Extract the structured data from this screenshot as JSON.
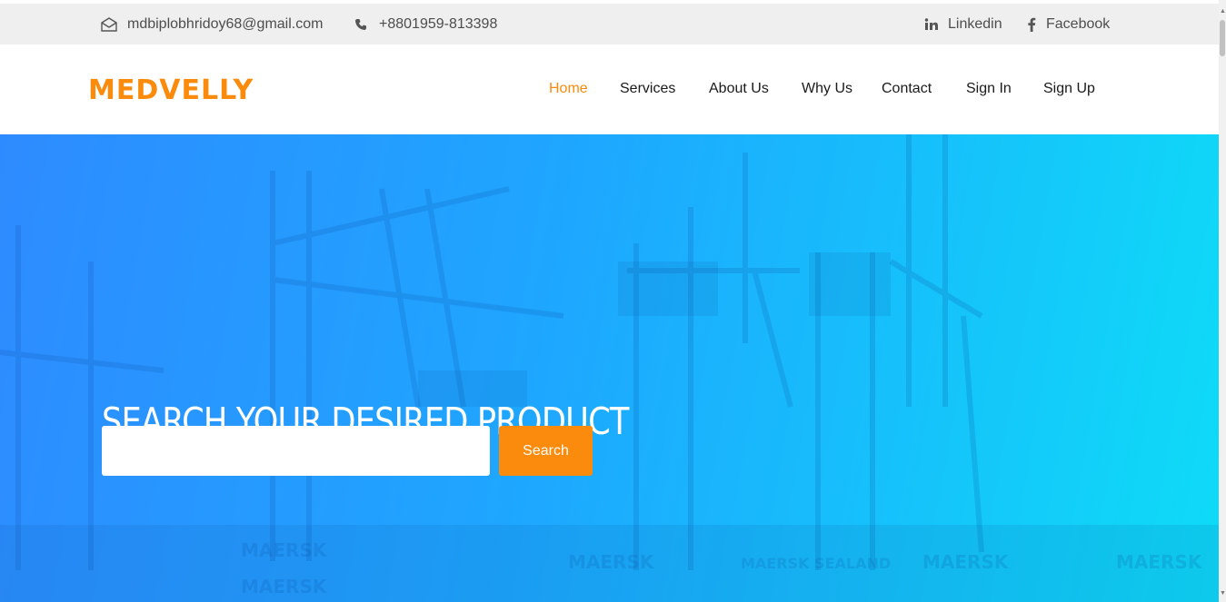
{
  "topbar": {
    "email": "mdbiplobhridoy68@gmail.com",
    "phone": "+8801959-813398",
    "linkedin_label": "Linkedin",
    "facebook_label": "Facebook",
    "icons": [
      "envelope-icon",
      "phone-icon",
      "linkedin-icon",
      "facebook-icon"
    ]
  },
  "navbar": {
    "logo": "MEDVELLY",
    "links": [
      "Home",
      "Services",
      "About Us",
      "Why Us",
      "Contact",
      "Sign In",
      "Sign Up"
    ],
    "active": "Home"
  },
  "hero": {
    "title": "SEARCH YOUR DESIRED PRODUCT",
    "search_placeholder": "",
    "search_value": "",
    "search_button": "Search",
    "container_text": [
      "MAERSK",
      "MAERSK",
      "MAERSK",
      "MAERSK SEALAND",
      "MAERSK",
      "MAERSK"
    ]
  },
  "colors": {
    "accent": "#fa8b0c",
    "hero_gradient_start": "#2e8bff",
    "hero_gradient_end": "#0edbf7",
    "topbar_bg": "#efefef"
  }
}
